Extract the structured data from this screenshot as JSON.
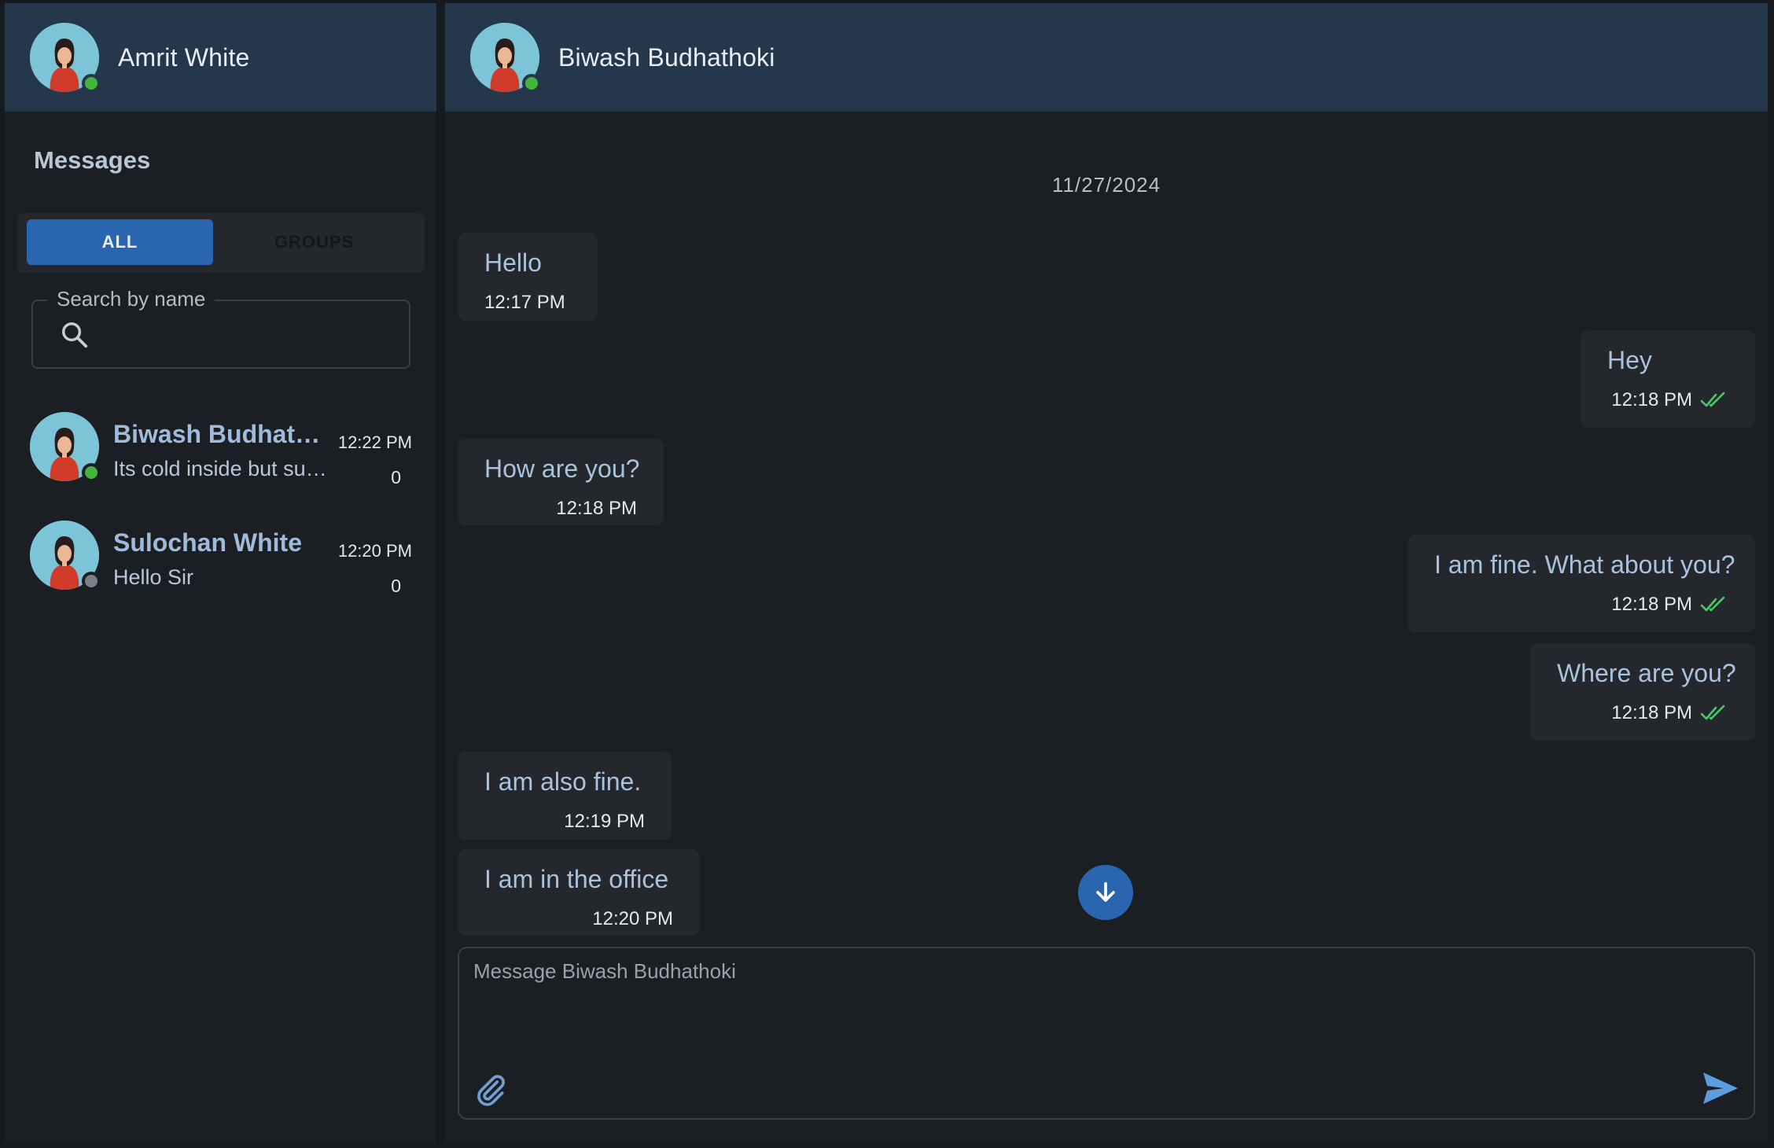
{
  "current_user": {
    "name": "Amrit White",
    "status": "online"
  },
  "sidebar": {
    "heading": "Messages",
    "tabs": [
      {
        "label": "ALL",
        "active": true
      },
      {
        "label": "GROUPS",
        "active": false
      }
    ],
    "search": {
      "label": "Search by name",
      "value": "",
      "icon": "search-icon"
    },
    "conversations": [
      {
        "name": "Biwash Budhathoki",
        "preview": "Its cold inside but sunny outside",
        "time": "12:22 PM",
        "unread": "0",
        "status": "online"
      },
      {
        "name": "Sulochan White",
        "preview": "Hello Sir",
        "time": "12:20 PM",
        "unread": "0",
        "status": "offline"
      }
    ]
  },
  "chat": {
    "contact": {
      "name": "Biwash Budhathoki",
      "status": "online"
    },
    "date": "11/27/2024",
    "messages": [
      {
        "text": "Hello",
        "time": "12:17 PM",
        "direction": "incoming"
      },
      {
        "text": "Hey",
        "time": "12:18 PM",
        "direction": "outgoing",
        "read": true
      },
      {
        "text": "How are you?",
        "time": "12:18 PM",
        "direction": "incoming"
      },
      {
        "text": "I am fine. What about you?",
        "time": "12:18 PM",
        "direction": "outgoing",
        "read": true
      },
      {
        "text": "Where are you?",
        "time": "12:18 PM",
        "direction": "outgoing",
        "read": true
      },
      {
        "text": "I am also fine.",
        "time": "12:19 PM",
        "direction": "incoming"
      },
      {
        "text": "I am in the office",
        "time": "12:20 PM",
        "direction": "incoming"
      }
    ],
    "composer": {
      "placeholder": "Message Biwash Budhathoki",
      "value": ""
    }
  },
  "colors": {
    "accent": "#2a65b0",
    "header": "#25384b",
    "background": "#1b1e22",
    "bubble": "#24282d",
    "online": "#44b53a",
    "read_check": "#4cc86a"
  }
}
